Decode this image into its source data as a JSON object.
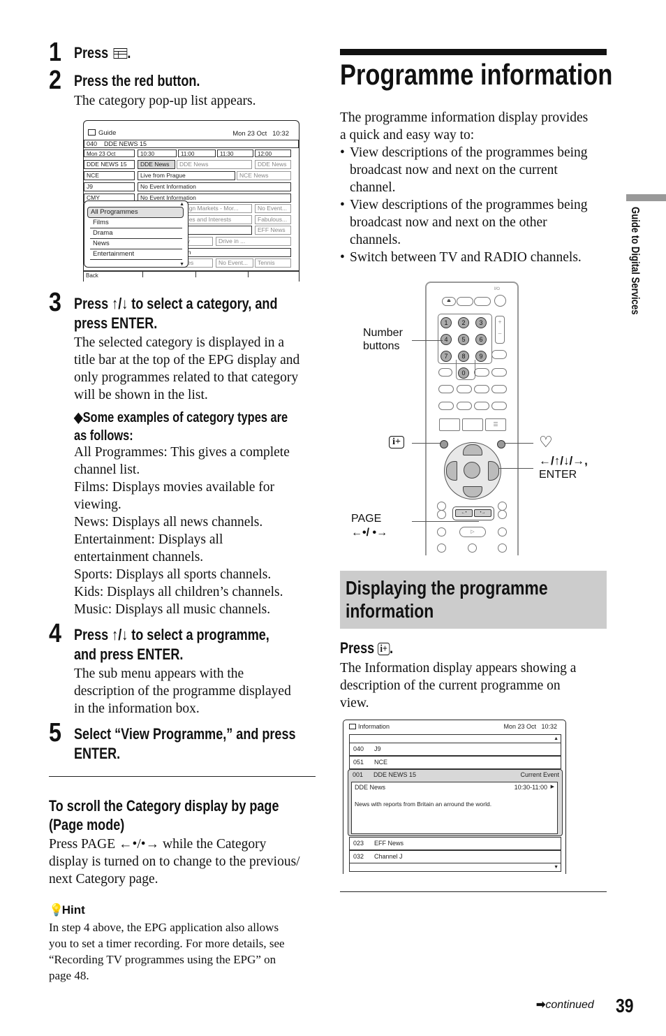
{
  "steps": [
    {
      "number": "1",
      "heading_before": "Press",
      "heading_icon": "guide-button-icon",
      "heading_after": "."
    },
    {
      "number": "2",
      "heading": "Press the red button.",
      "body": "The category pop-up list appears."
    },
    {
      "number": "3",
      "heading_line1_before": "Press",
      "heading_line1_arrows": "↑/↓",
      "heading_line1_after": "to select a category, and",
      "heading_line2": "press ENTER.",
      "body_lines": [
        "The selected category is displayed in a",
        "title bar at the top of the EPG display and",
        "only programmes related to that category",
        "will be shown in the list."
      ]
    },
    {
      "number": "4",
      "heading_line1_before": "Press",
      "heading_line1_arrows": "↑/↓",
      "heading_line1_after": "to select a programme,",
      "heading_line2": "and press ENTER.",
      "body_lines": [
        "The sub menu appears with the",
        "description of the programme displayed",
        "in the information box."
      ]
    },
    {
      "number": "5",
      "heading_line1": "Select “View Programme,” and press",
      "heading_line2": "ENTER."
    }
  ],
  "category_examples": {
    "heading_line1": "◆Some examples of category types are",
    "heading_line2": "as follows:",
    "lines": [
      "All Programmes: This gives a complete",
      "channel list.",
      "Films: Displays movies available for",
      "viewing.",
      "News: Displays all news channels.",
      "Entertainment: Displays all",
      "entertainment channels.",
      "Sports: Displays all sports channels.",
      "Kids: Displays all children’s channels.",
      "Music: Displays all music channels."
    ]
  },
  "epg_screen": {
    "title": "Guide",
    "datetime": "Mon 23 Oct   10:32",
    "channel_bar": "040    DDE NEWS 15",
    "time_header": [
      "Mon 23 Oct",
      "10:30",
      "11:00",
      "11:30",
      "12:00"
    ],
    "rows": [
      {
        "channel": "DDE NEWS 15",
        "events": [
          "DDE News",
          "DDE News",
          "DDE News"
        ]
      },
      {
        "channel": "NCE",
        "events": [
          "Live from Prague",
          "NCE News"
        ]
      },
      {
        "channel": "J9",
        "events": [
          "No Event Information"
        ]
      },
      {
        "channel": "CMY",
        "events": [
          "No Event Information"
        ]
      },
      {
        "channel": "",
        "events": [
          "...eign Markets - Mor...",
          "No Event..."
        ]
      },
      {
        "channel": "",
        "events": [
          "...bies and Interests",
          "Fabulous..."
        ]
      },
      {
        "channel": "",
        "events": [
          "",
          "EFF News"
        ]
      },
      {
        "channel": "",
        "events": [
          "...ily",
          "Drive in ..."
        ]
      },
      {
        "channel": "",
        "events": [
          "...on"
        ]
      },
      {
        "channel": "",
        "events": [
          "...ses",
          "No Event...",
          "Tennis"
        ]
      }
    ],
    "footer": "Back",
    "category_popup": [
      "All Programmes",
      "Films",
      "Drama",
      "News",
      "Entertainment"
    ]
  },
  "scroll_section": {
    "heading_line1": "To scroll the Category display by page",
    "heading_line2": "(Page mode)",
    "body_lines": [
      "Press PAGE ←•/•→ while the Category",
      "display is turned on to change to the previous/",
      "next Category page."
    ]
  },
  "hint": {
    "title": "Hint",
    "lines": [
      "In step 4 above, the EPG application also allows",
      "you to set a timer recording. For more details, see",
      "“Recording TV programmes using the EPG” on",
      "page 48."
    ]
  },
  "right": {
    "title": "Programme information",
    "intro_lines": [
      "The programme information display provides",
      "a quick and easy way to:"
    ],
    "bullets": [
      [
        "View descriptions of the programmes being",
        "broadcast now and next on the current",
        "channel."
      ],
      [
        "View descriptions of the programmes being",
        "broadcast now and next on the other",
        "channels."
      ],
      [
        "Switch between TV and RADIO channels."
      ]
    ],
    "remote_labels": {
      "number_buttons_1": "Number",
      "number_buttons_2": "buttons",
      "info_button": "i+",
      "favourite": "♡",
      "arrows": "←/↑/↓/→,",
      "enter": "ENTER",
      "page": "PAGE",
      "page_arrows": "←•/ •→"
    },
    "remote_numbers": [
      "1",
      "2",
      "3",
      "4",
      "5",
      "6",
      "7",
      "8",
      "9",
      "0"
    ],
    "subsection_title_1": "Displaying the programme",
    "subsection_title_2": "information",
    "press_label": "Press",
    "press_icon_text": "i+",
    "press_after": ".",
    "press_body_lines": [
      "The Information display appears showing a",
      "description of the current programme on",
      "view."
    ]
  },
  "info_screen": {
    "title": "Information",
    "datetime": "Mon 23 Oct   10:32",
    "rows_top": [
      {
        "num": "040",
        "name": "J9"
      },
      {
        "num": "051",
        "name": "NCE"
      }
    ],
    "selected": {
      "num": "001",
      "name": "DDE NEWS 15",
      "status": "Current Event",
      "event_title": "DDE News",
      "event_time": "10:30-11:00",
      "description": "News with reports from Britain an arround the world."
    },
    "rows_bottom": [
      {
        "num": "023",
        "name": "EFF News"
      },
      {
        "num": "032",
        "name": "Channel J"
      }
    ]
  },
  "side_tab": "Guide to Digital Services",
  "footer": {
    "continued": "continued",
    "page_number": "39"
  }
}
